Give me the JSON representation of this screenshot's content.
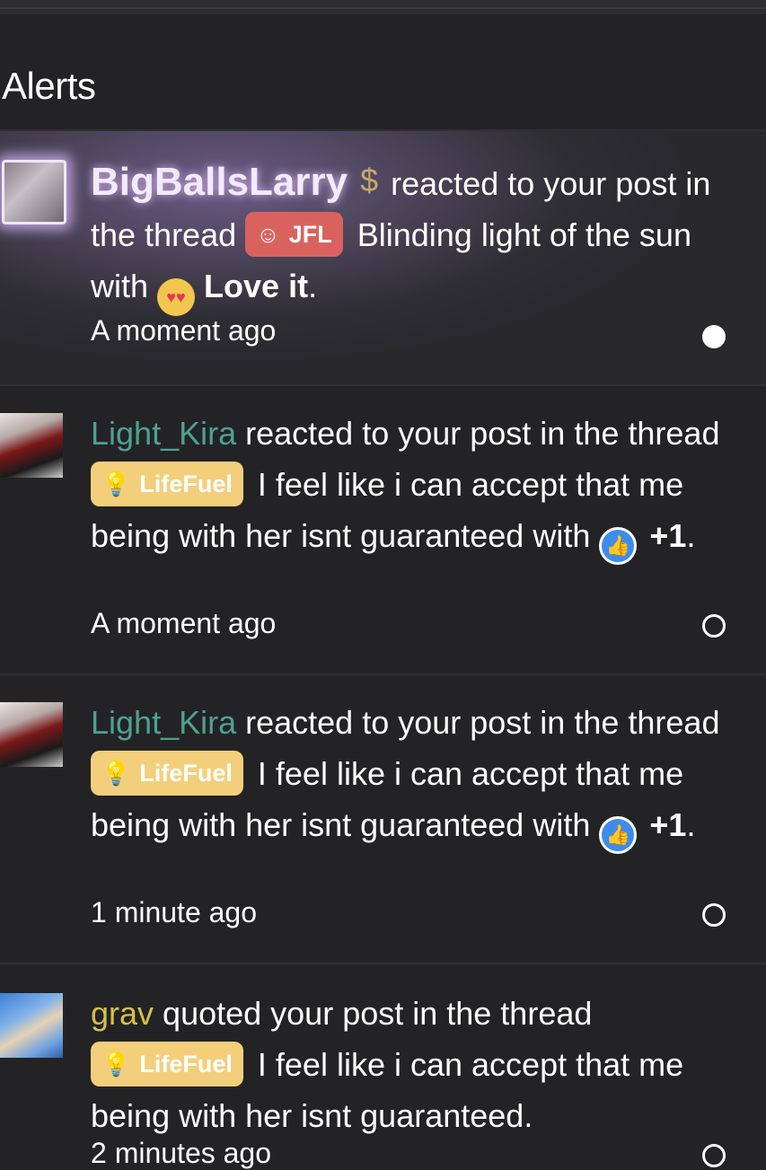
{
  "page": {
    "title": "Alerts"
  },
  "alerts": [
    {
      "user": "BigBallsLarry",
      "user_badge": "$",
      "text1": "reacted to your post in the thread",
      "prefix": "JFL",
      "thread": "Blinding light of the sun",
      "with": "with",
      "reaction": "Love it",
      "end": ".",
      "time": "A moment ago",
      "read": false
    },
    {
      "user": "Light_Kira",
      "text1": "reacted to your post in the",
      "text2": "thread",
      "prefix": "LifeFuel",
      "thread": "I feel like i can accept that me being with her isnt guaranteed",
      "with": "with",
      "reaction": "+1",
      "end": ".",
      "time": "A moment ago",
      "read": true
    },
    {
      "user": "Light_Kira",
      "text1": "reacted to your post in the",
      "text2": "thread",
      "prefix": "LifeFuel",
      "thread": "I feel like i can accept that me being with her isnt guaranteed",
      "with": "with",
      "reaction": "+1",
      "end": ".",
      "time": "1 minute ago",
      "read": true
    },
    {
      "user": "grav",
      "text1": "quoted your post in the thread",
      "prefix": "LifeFuel",
      "thread": "I feel like i can accept that me being with her isnt guaranteed.",
      "time": "2 minutes ago",
      "read": true
    }
  ],
  "icons": {
    "jfl_icon": "emoji-grin-icon",
    "lifefuel_icon": "lightbulb-icon",
    "love_icon": "heart-eyes-icon",
    "like_icon": "thumbs-up-icon"
  },
  "colors": {
    "background": "#232325",
    "kira_username": "#4ea28e",
    "grav_username": "#d4c04a",
    "jfl_prefix": "#d9625f",
    "lifefuel_prefix": "#f3cf7c",
    "like_blue": "#3c8cf0"
  }
}
